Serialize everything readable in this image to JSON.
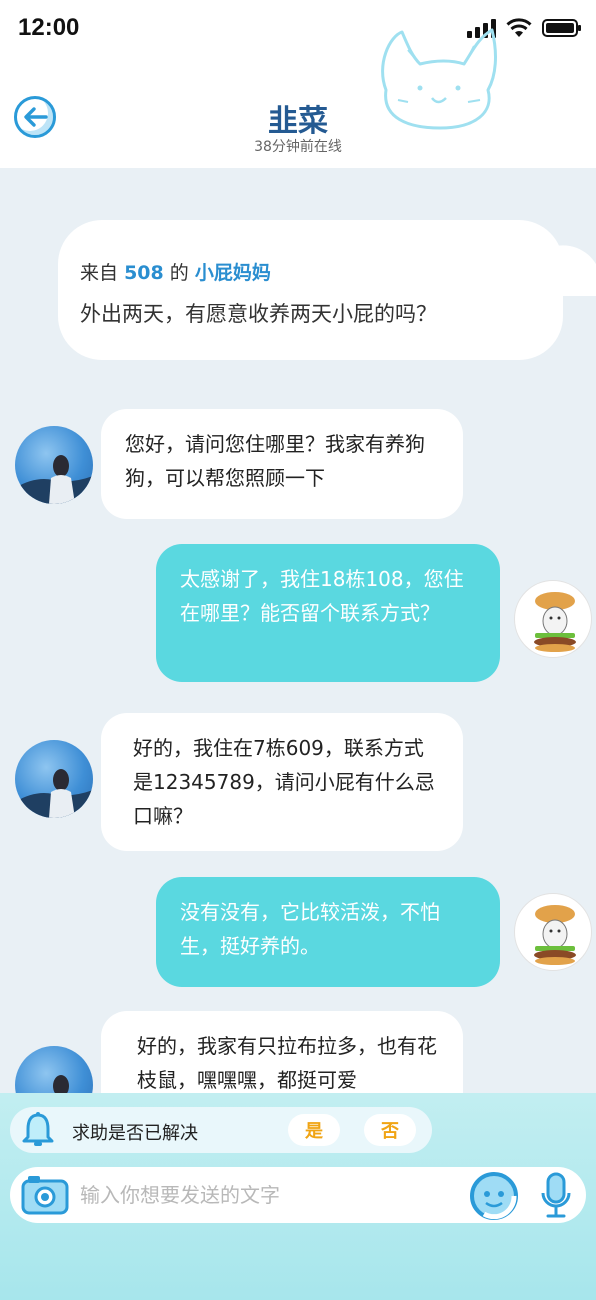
{
  "status": {
    "time": "12:00"
  },
  "header": {
    "title": "韭菜",
    "subtitle": "38分钟前在线"
  },
  "post": {
    "prefix": "来自",
    "room": "508",
    "mid": "的",
    "owner": "小屁妈妈",
    "text": "外出两天，有愿意收养两天小屁的吗？"
  },
  "messages": [
    {
      "side": "in",
      "text": "您好，请问您住哪里？我家有养狗狗，可以帮您照顾一下"
    },
    {
      "side": "out",
      "text": "太感谢了，我住18栋108，您住在哪里？能否留个联系方式？"
    },
    {
      "side": "in",
      "text": "好的，我住在7栋609，联系方式是12345789，请问小屁有什么忌口嘛？"
    },
    {
      "side": "out",
      "text": "没有没有，它比较活泼，不怕生，挺好养的。"
    },
    {
      "side": "in",
      "text": "好的，我家有只拉布拉多，也有花枝鼠，嘿嘿嘿，都挺可爱"
    }
  ],
  "resolve": {
    "label": "求助是否已解决",
    "yes": "是",
    "no": "否"
  },
  "input": {
    "placeholder": "输入你想要发送的文字",
    "value": ""
  },
  "colors": {
    "accent": "#2a9ad8",
    "out_bubble": "#5ad8e0",
    "title": "#245a92",
    "yes_no": "#f0a414"
  },
  "icons": [
    "signal-icon",
    "wifi-icon",
    "battery-icon",
    "back-arrow-icon",
    "cat-doodle-icon",
    "bell-icon",
    "camera-icon",
    "emoji-icon",
    "mic-icon"
  ]
}
